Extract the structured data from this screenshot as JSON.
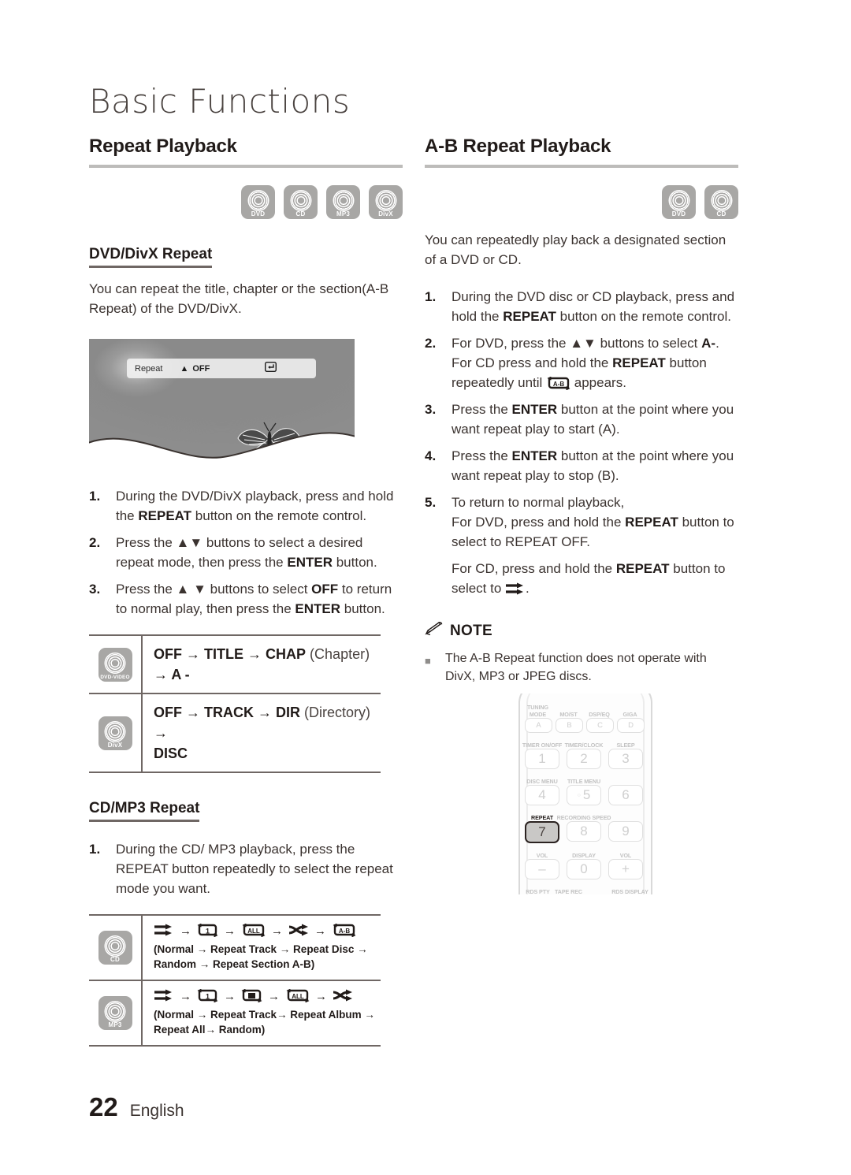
{
  "chapter_title": "Basic Functions",
  "footer": {
    "page_number": "22",
    "language": "English"
  },
  "left": {
    "heading": "Repeat Playback",
    "badges": [
      {
        "label": "DVD"
      },
      {
        "label": "CD"
      },
      {
        "label": "MP3"
      },
      {
        "label": "DivX"
      }
    ],
    "sub_heading": "DVD/DivX Repeat",
    "intro": "You can repeat the title, chapter or the section(A-B Repeat) of the DVD/DivX.",
    "tv_screenshot": {
      "osd_label": "Repeat",
      "osd_updown_icon": "up-down-arrow-icon",
      "osd_value": "OFF",
      "osd_enter_icon": "enter-return-icon"
    },
    "steps": [
      {
        "n": "1.",
        "parts": [
          {
            "t": "During the DVD/DivX playback, press and hold the ",
            "b": false
          },
          {
            "t": "REPEAT",
            "b": true
          },
          {
            "t": " button on the remote control.",
            "b": false
          }
        ]
      },
      {
        "n": "2.",
        "parts": [
          {
            "t": "Press the ▲▼ buttons to select a desired repeat mode, then press the ",
            "b": false
          },
          {
            "t": "ENTER",
            "b": true
          },
          {
            "t": " button.",
            "b": false
          }
        ]
      },
      {
        "n": "3.",
        "parts": [
          {
            "t": "Press the ▲ ▼ buttons to select ",
            "b": false
          },
          {
            "t": "OFF",
            "b": true
          },
          {
            "t": " to return to normal play, then press the ",
            "b": false
          },
          {
            "t": "ENTER",
            "b": true
          },
          {
            "t": " button.",
            "b": false
          }
        ]
      }
    ],
    "dvd_table": [
      {
        "badge": "DVD-VIDEO",
        "lines": [
          [
            {
              "t": "OFF",
              "b": true
            },
            {
              "t": " → ",
              "b": true
            },
            {
              "t": "TITLE",
              "b": true
            },
            {
              "t": " → ",
              "b": true
            },
            {
              "t": "CHAP",
              "b": true
            },
            {
              "t": " (Chapter)",
              "b": false
            },
            {
              "t": " → ",
              "b": true
            },
            {
              "t": "A -",
              "b": true
            }
          ]
        ]
      },
      {
        "badge": "DivX",
        "lines": [
          [
            {
              "t": "OFF",
              "b": true
            },
            {
              "t": " → ",
              "b": true
            },
            {
              "t": "TRACK",
              "b": true
            },
            {
              "t": " → ",
              "b": true
            },
            {
              "t": "DIR",
              "b": true
            },
            {
              "t": " (Directory)",
              "b": false
            },
            {
              "t": " →",
              "b": true
            }
          ],
          [
            {
              "t": "DISC",
              "b": true
            }
          ]
        ]
      }
    ],
    "sub_heading_2": "CD/MP3 Repeat",
    "steps_2": [
      {
        "n": "1.",
        "parts": [
          {
            "t": "During the CD/ MP3 playback, press the REPEAT button repeatedly to select the repeat mode you want.",
            "b": false
          }
        ]
      }
    ],
    "cdmp3_table": [
      {
        "badge": "CD",
        "icons": [
          "normal-play-icon",
          "repeat-track-icon",
          "repeat-all-icon",
          "random-shuffle-icon",
          "repeat-ab-icon"
        ],
        "caption": "(Normal → Repeat Track → Repeat Disc → Random → Repeat Section A-B)"
      },
      {
        "badge": "MP3",
        "icons": [
          "normal-play-icon",
          "repeat-track-icon",
          "repeat-album-icon",
          "repeat-all-icon",
          "random-shuffle-icon"
        ],
        "caption": "(Normal  → Repeat Track→ Repeat Album → Repeat All→ Random)"
      }
    ]
  },
  "right": {
    "heading": "A-B Repeat Playback",
    "badges": [
      {
        "label": "DVD"
      },
      {
        "label": "CD"
      }
    ],
    "intro": "You can repeatedly play back a designated section of a DVD or CD.",
    "steps": [
      {
        "n": "1.",
        "parts": [
          {
            "t": "During the DVD disc or CD playback, press and hold the ",
            "b": false
          },
          {
            "t": "REPEAT",
            "b": true
          },
          {
            "t": " button on the remote control.",
            "b": false
          }
        ]
      },
      {
        "n": "2.",
        "parts": [
          {
            "t": "For DVD, press the ▲▼ buttons to select ",
            "b": false
          },
          {
            "t": "A-",
            "b": true
          },
          {
            "t": ". For CD press and hold the ",
            "b": false
          },
          {
            "t": "REPEAT",
            "b": true
          },
          {
            "t": " button repeatedly until ",
            "b": false
          },
          {
            "t": "[ICON:repeat-ab-icon]",
            "b": false
          },
          {
            "t": " appears.",
            "b": false
          }
        ]
      },
      {
        "n": "3.",
        "parts": [
          {
            "t": "Press the ",
            "b": false
          },
          {
            "t": "ENTER",
            "b": true
          },
          {
            "t": " button at the point where you want repeat play to start (A).",
            "b": false
          }
        ]
      },
      {
        "n": "4.",
        "parts": [
          {
            "t": "Press the ",
            "b": false
          },
          {
            "t": "ENTER",
            "b": true
          },
          {
            "t": " button at the point where you want repeat play to stop (B).",
            "b": false
          }
        ]
      },
      {
        "n": "5.",
        "parts": [
          {
            "t": "To return to normal playback,\nFor DVD, press and hold the ",
            "b": false
          },
          {
            "t": "REPEAT",
            "b": true
          },
          {
            "t": " button to select to REPEAT OFF.",
            "b": false
          }
        ]
      },
      {
        "n": "",
        "parts": [
          {
            "t": "For CD, press and hold the ",
            "b": false
          },
          {
            "t": "REPEAT",
            "b": true
          },
          {
            "t": " button to select to ",
            "b": false
          },
          {
            "t": "[ICON:normal-play-icon]",
            "b": false
          },
          {
            "t": ".",
            "b": false
          }
        ]
      }
    ],
    "note": {
      "icon": "pencil-note-icon",
      "title": "NOTE",
      "items": [
        "The A-B Repeat function does not operate with DivX, MP3 or JPEG discs."
      ]
    }
  },
  "remote": {
    "rows": [
      {
        "keys": [
          {
            "label": "TUNING\nMODE",
            "key": "A",
            "type": "letter",
            "highlight": false
          },
          {
            "label": "MO/ST",
            "key": "B",
            "type": "letter",
            "highlight": false
          },
          {
            "label": "DSP/EQ",
            "key": "C",
            "type": "letter",
            "highlight": false
          },
          {
            "label": "GIGA",
            "key": "D",
            "type": "letter",
            "highlight": false
          }
        ]
      },
      {
        "keys": [
          {
            "label": "TIMER ON/OFF",
            "key": "1",
            "type": "num",
            "highlight": false
          },
          {
            "label": "TIMER/CLOCK",
            "key": "2",
            "type": "num",
            "highlight": false
          },
          {
            "label": "SLEEP",
            "key": "3",
            "type": "num",
            "highlight": false
          }
        ]
      },
      {
        "keys": [
          {
            "label": "DISC MENU",
            "key": "4",
            "type": "num",
            "highlight": false
          },
          {
            "label": "TITLE MENU",
            "key": "5",
            "type": "num-dot",
            "highlight": false
          },
          {
            "label": "",
            "key": "6",
            "type": "num",
            "highlight": false
          }
        ]
      },
      {
        "keys": [
          {
            "label": "REPEAT",
            "key": "7",
            "type": "num",
            "highlight": true
          },
          {
            "label": "RECORDING SPEED",
            "key": "8",
            "type": "num",
            "highlight": false
          },
          {
            "label": "",
            "key": "9",
            "type": "num",
            "highlight": false
          }
        ]
      },
      {
        "keys": [
          {
            "label": "VOL",
            "key": "–",
            "type": "num",
            "highlight": false
          },
          {
            "label": "DISPLAY",
            "key": "0",
            "type": "num",
            "highlight": false
          },
          {
            "label": "VOL",
            "key": "+",
            "type": "num",
            "highlight": false
          }
        ]
      },
      {
        "keys": [
          {
            "label": "RDS PTY",
            "key": "",
            "type": "half",
            "highlight": false
          },
          {
            "label": "TAPE REC",
            "key": "",
            "type": "half",
            "highlight": false
          },
          {
            "label": "",
            "key": "",
            "type": "half",
            "highlight": false
          },
          {
            "label": "RDS DISPLAY",
            "key": "",
            "type": "half",
            "highlight": false
          }
        ]
      }
    ]
  }
}
